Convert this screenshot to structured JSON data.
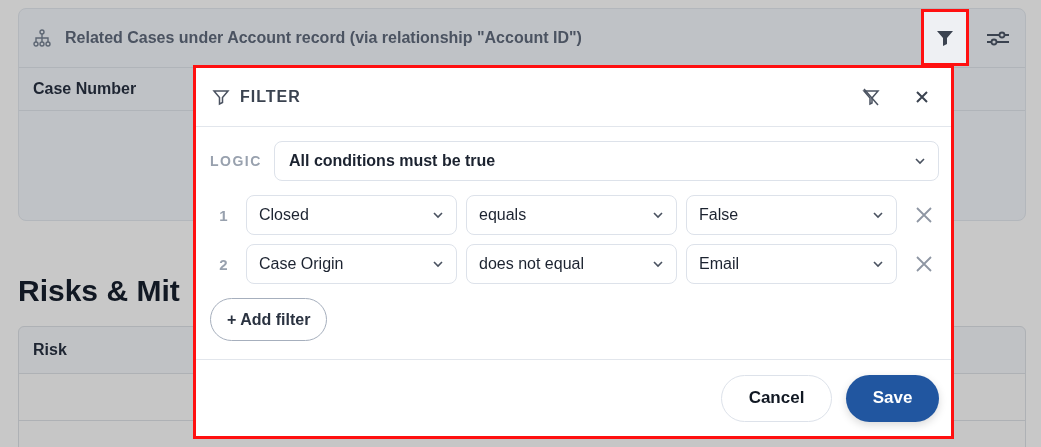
{
  "related_card": {
    "title": "Related Cases under Account record (via relationship \"Account ID\")",
    "filter_button": {
      "highlighted": true
    },
    "columns": [
      "Case Number"
    ]
  },
  "section": {
    "heading": "Risks & Mit",
    "table": {
      "columns": [
        "Risk"
      ]
    }
  },
  "filter_popover": {
    "highlighted": true,
    "title": "FILTER",
    "logic_label": "LOGIC",
    "logic_value": "All conditions must be true",
    "filters": [
      {
        "number": "1",
        "field": "Closed",
        "operator": "equals",
        "value": "False"
      },
      {
        "number": "2",
        "field": "Case Origin",
        "operator": "does not equal",
        "value": "Email"
      }
    ],
    "add_filter": "+ Add filter",
    "cancel": "Cancel",
    "save": "Save"
  }
}
